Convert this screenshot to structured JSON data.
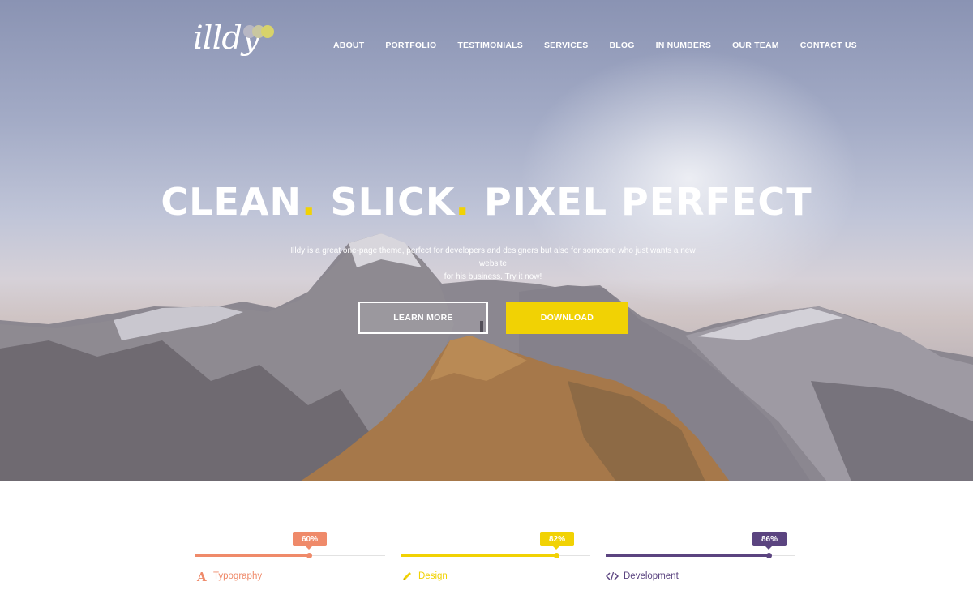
{
  "brand": {
    "logo_text": "illdy",
    "accent": "#f1d204",
    "logo_dot_colors": [
      "#b7b7c4",
      "#c9c7a0",
      "#d8d36a"
    ]
  },
  "nav": {
    "items": [
      {
        "label": "ABOUT"
      },
      {
        "label": "PORTFOLIO"
      },
      {
        "label": "TESTIMONIALS"
      },
      {
        "label": "SERVICES"
      },
      {
        "label": "BLOG"
      },
      {
        "label": "IN NUMBERS"
      },
      {
        "label": "OUR TEAM"
      },
      {
        "label": "CONTACT US"
      }
    ]
  },
  "hero": {
    "headline_parts": [
      "CLEAN",
      ".",
      " SLICK",
      ".",
      " PIXEL PERFECT"
    ],
    "subtext_line1": "Illdy is a great one-page theme, perfect for developers and designers but also for someone who just wants a new website",
    "subtext_line2": "for his business. Try it now!",
    "learn_more_label": "LEARN MORE",
    "download_label": "DOWNLOAD"
  },
  "skills": [
    {
      "name": "Typography",
      "percent": 60,
      "percent_label": "60%",
      "color": "#ef8a6a",
      "icon": "font-icon"
    },
    {
      "name": "Design",
      "percent": 82,
      "percent_label": "82%",
      "color": "#f1d204",
      "icon": "pencil-icon"
    },
    {
      "name": "Development",
      "percent": 86,
      "percent_label": "86%",
      "color": "#5b4480",
      "icon": "code-icon"
    }
  ]
}
